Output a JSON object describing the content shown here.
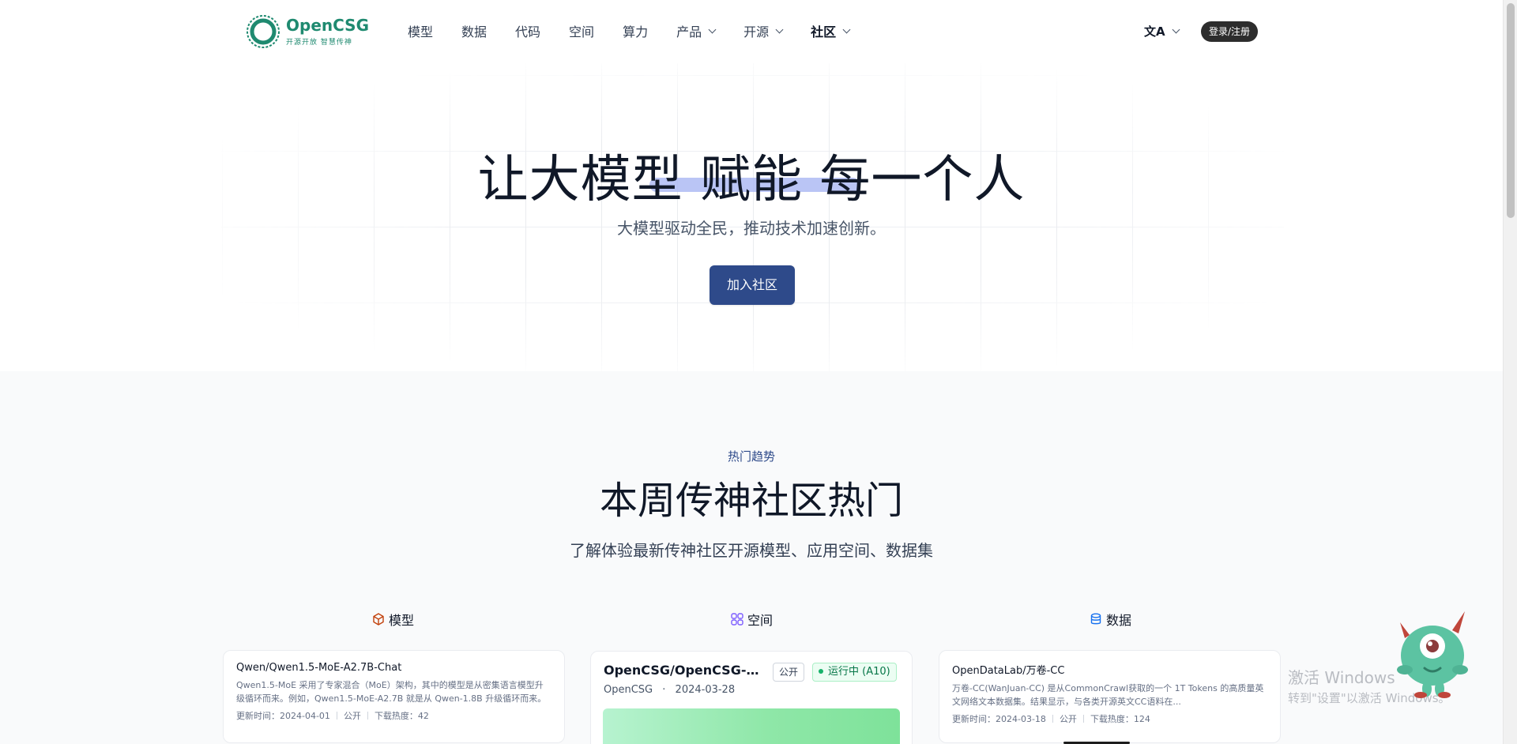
{
  "header": {
    "logo_name": "OpenCSG",
    "logo_slogan": "开源开放 智慧传神",
    "nav": [
      {
        "label": "模型"
      },
      {
        "label": "数据"
      },
      {
        "label": "代码"
      },
      {
        "label": "空间"
      },
      {
        "label": "算力"
      },
      {
        "label": "产品"
      },
      {
        "label": "开源"
      },
      {
        "label": "社区"
      }
    ],
    "lang_icon": "文A",
    "login_label": "登录/注册"
  },
  "hero": {
    "title_prefix": "让大模型",
    "title_highlight": "赋能",
    "title_suffix": "每一个人",
    "subtitle": "大模型驱动全民，推动技术加速创新。",
    "join_label": "加入社区",
    "accent_color": "#2e4a8a",
    "highlight_color": "#a9b6f2"
  },
  "trending": {
    "tag": "热门趋势",
    "title": "本周传神社区热门",
    "subtitle": "了解体验最新传神社区开源模型、应用空间、数据集",
    "columns": {
      "models": {
        "label": "模型",
        "icon": "cube-icon"
      },
      "spaces": {
        "label": "空间",
        "icon": "apps-grid-icon"
      },
      "datasets": {
        "label": "数据",
        "icon": "database-icon"
      }
    },
    "model_card": {
      "title": "Qwen/Qwen1.5-MoE-A2.7B-Chat",
      "desc": "Qwen1.5-MoE 采用了专家混合（MoE）架构，其中的模型是从密集语言模型升级循环而来。例如，Qwen1.5-MoE-A2.7B 就是从 Qwen-1.8B 升级循环而来。",
      "updated": "更新时间：2024-04-01",
      "visibility": "公开",
      "downloads": "下载热度：42"
    },
    "space_card": {
      "title": "OpenCSG/OpenCSG-De...",
      "public_badge": "公开",
      "status_badge": "运行中 (A10)",
      "owner": "OpenCSG",
      "date": "2024-03-28"
    },
    "dataset_card": {
      "title": "OpenDataLab/万卷-CC",
      "desc": "万卷-CC(WanJuan-CC) 是从CommonCrawl获取的一个 1T Tokens 的高质量英文网络文本数据集。结果显示，与各类开源英文CC语料在...",
      "updated": "更新时间：2024-03-18",
      "visibility": "公开",
      "downloads": "下载热度：124"
    }
  },
  "watermark": {
    "line1": "激活 Windows",
    "line2": "转到\"设置\"以激活 Windows。"
  }
}
